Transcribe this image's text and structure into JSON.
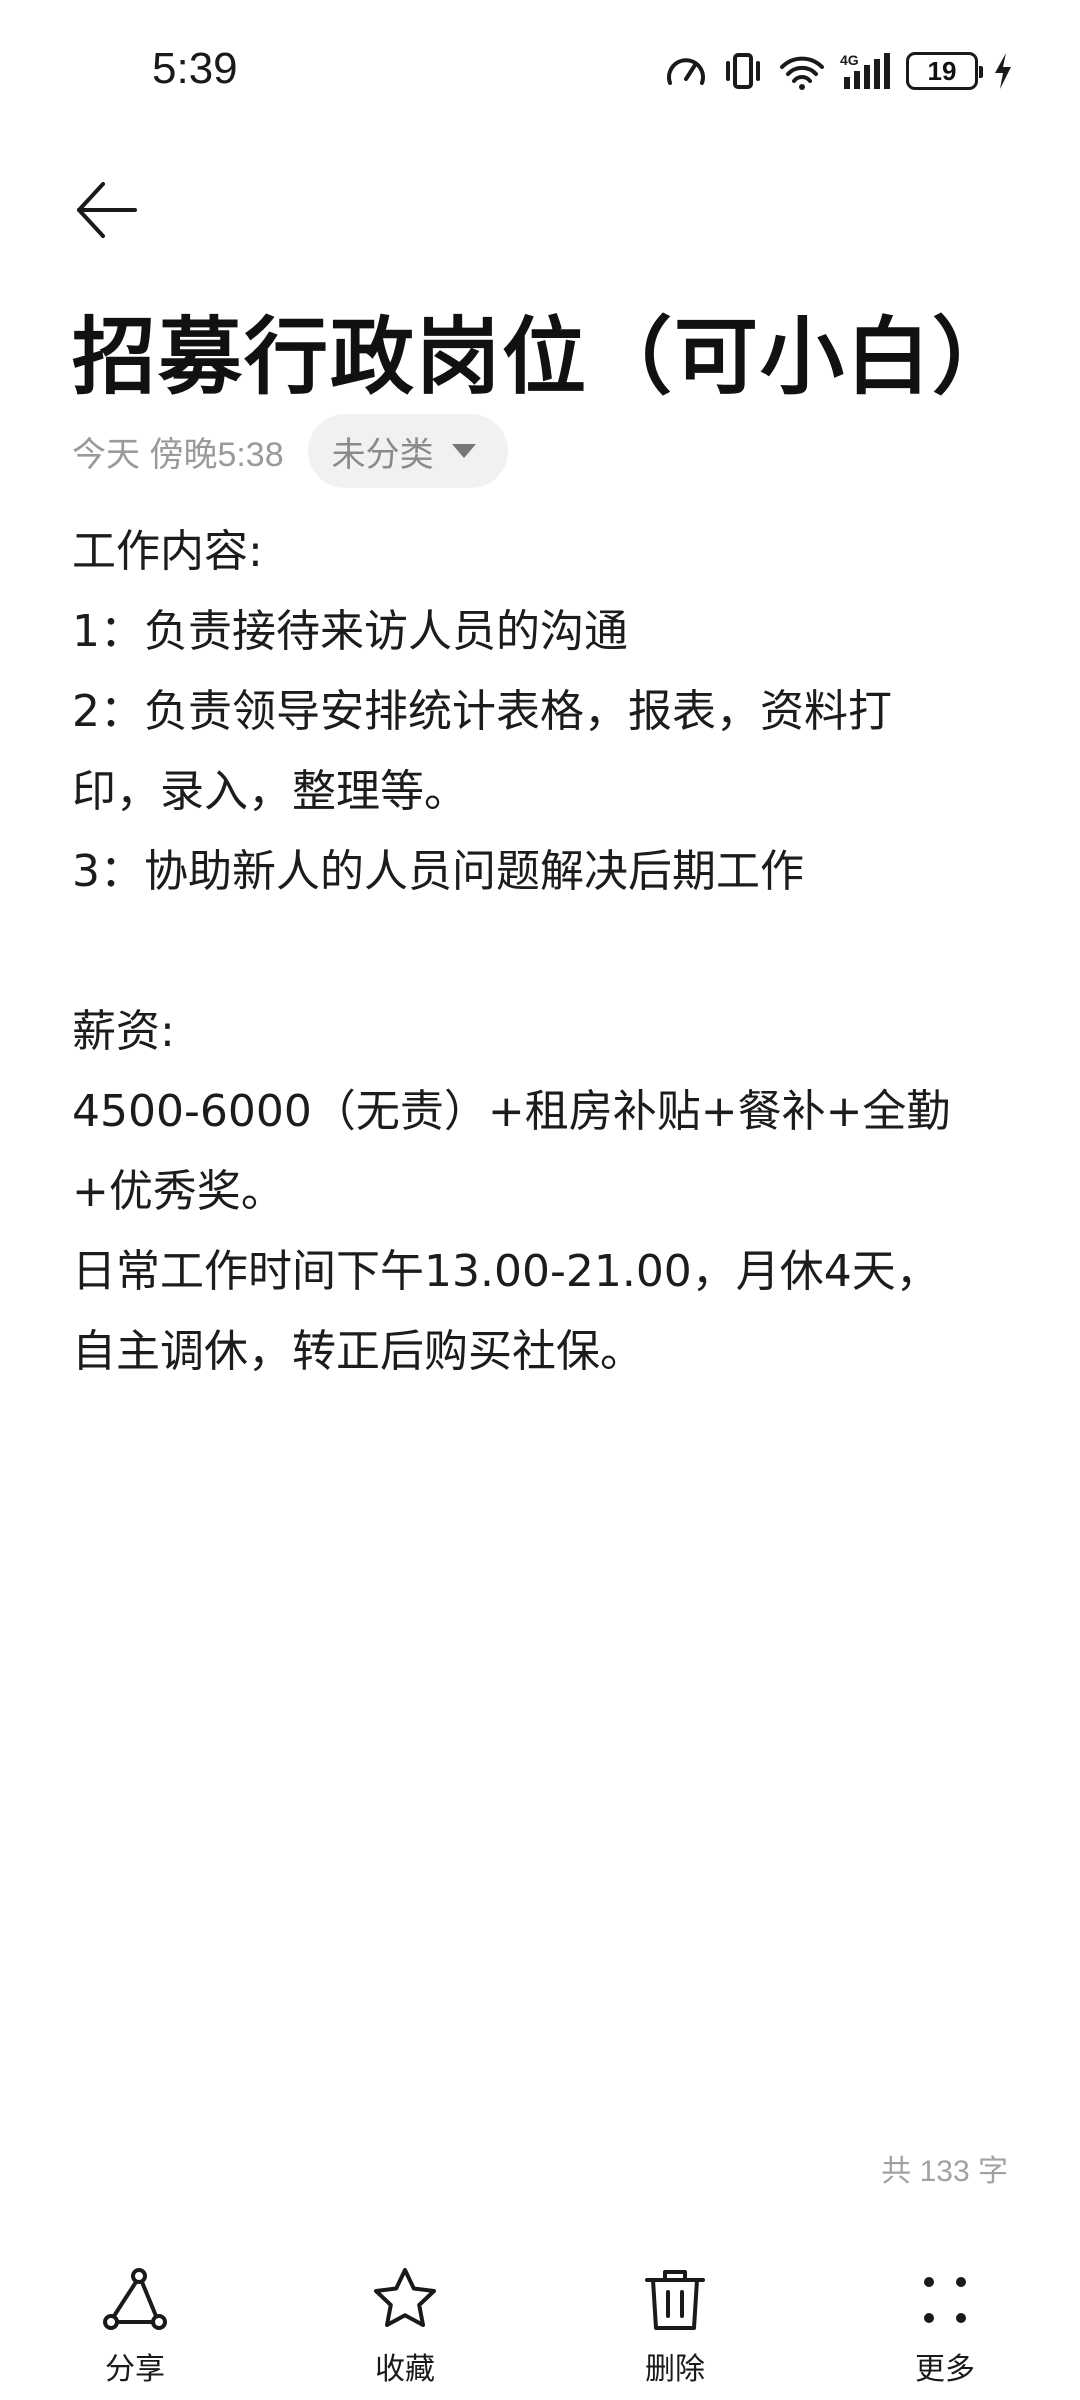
{
  "status_bar": {
    "time": "5:39",
    "network": "4G",
    "battery": "19",
    "icons": [
      "speed-icon",
      "vibrate-icon",
      "wifi-icon",
      "signal-icon",
      "battery-icon",
      "charging-icon"
    ]
  },
  "note": {
    "title": "招募行政岗位（可小白）",
    "date": "今天 傍晚5:38",
    "category": "未分类",
    "lines": [
      "工作内容:",
      "1：负责接待来访人员的沟通",
      "2：负责领导安排统计表格，报表，资料打",
      "印，录入，整理等。",
      "3：协助新人的人员问题解决后期工作",
      "",
      "薪资:",
      "4500-6000（无责）+租房补贴+餐补+全勤",
      "+优秀奖。",
      "日常工作时间下午13.00-21.00，月休4天，",
      "自主调休，转正后购买社保。"
    ],
    "word_count": "共 133 字"
  },
  "toolbar": {
    "share": "分享",
    "favorite": "收藏",
    "delete": "删除",
    "more": "更多"
  },
  "colors": {
    "text": "#111111",
    "muted": "#9a9a9a",
    "chip_bg": "#f1f1f1"
  }
}
